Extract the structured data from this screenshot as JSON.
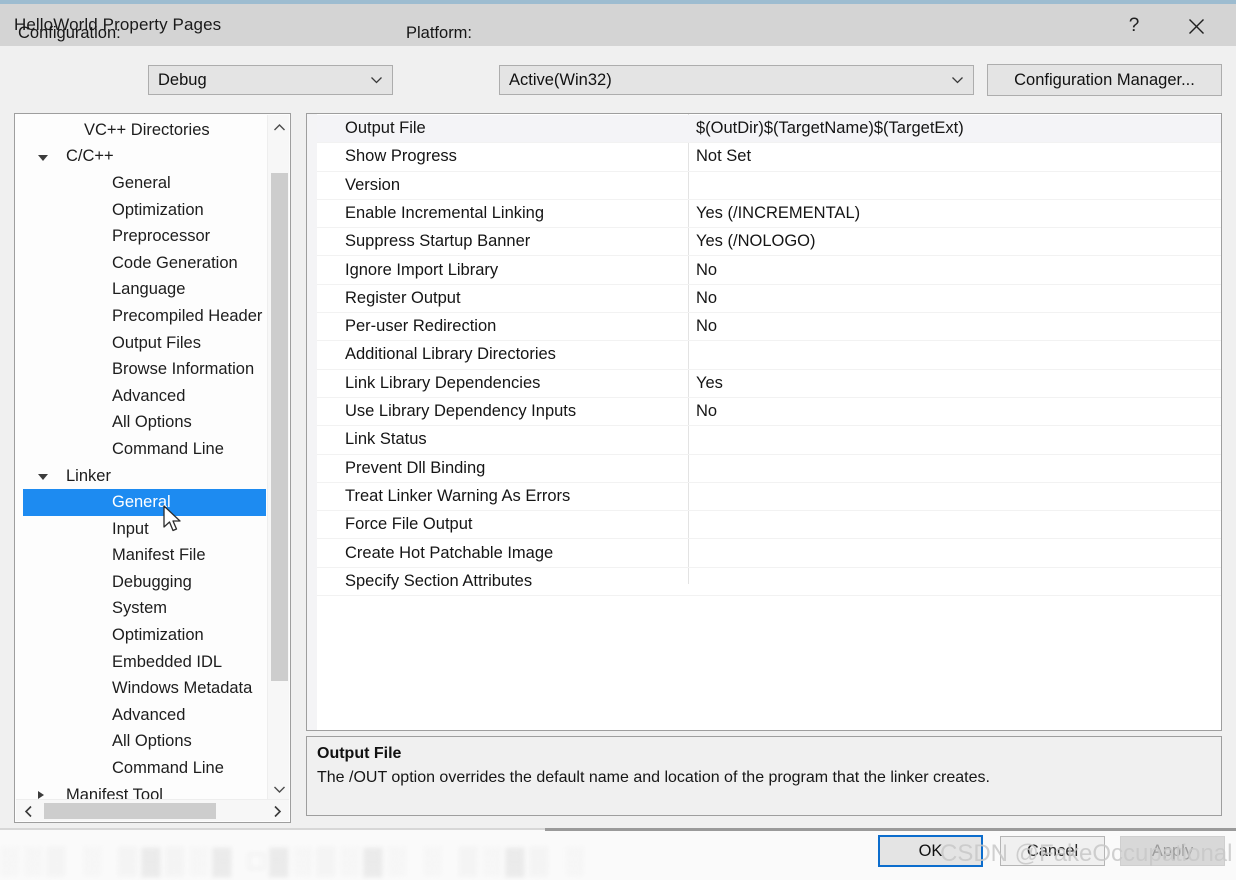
{
  "window": {
    "title": "HelloWorld Property Pages",
    "help_icon": "?",
    "close_icon": "close-icon"
  },
  "configbar": {
    "configuration_label": "Configuration:",
    "configuration_value": "Debug",
    "platform_label": "Platform:",
    "platform_value": "Active(Win32)",
    "configuration_manager_button": "Configuration Manager..."
  },
  "tree": {
    "items": [
      {
        "label": "VC++ Directories",
        "indent": 2,
        "expander": "none",
        "selected": false
      },
      {
        "label": "C/C++",
        "indent": 1,
        "expander": "open",
        "selected": false
      },
      {
        "label": "General",
        "indent": 3,
        "expander": "none",
        "selected": false
      },
      {
        "label": "Optimization",
        "indent": 3,
        "expander": "none",
        "selected": false
      },
      {
        "label": "Preprocessor",
        "indent": 3,
        "expander": "none",
        "selected": false
      },
      {
        "label": "Code Generation",
        "indent": 3,
        "expander": "none",
        "selected": false
      },
      {
        "label": "Language",
        "indent": 3,
        "expander": "none",
        "selected": false
      },
      {
        "label": "Precompiled Header",
        "indent": 3,
        "expander": "none",
        "selected": false
      },
      {
        "label": "Output Files",
        "indent": 3,
        "expander": "none",
        "selected": false
      },
      {
        "label": "Browse Information",
        "indent": 3,
        "expander": "none",
        "selected": false
      },
      {
        "label": "Advanced",
        "indent": 3,
        "expander": "none",
        "selected": false
      },
      {
        "label": "All Options",
        "indent": 3,
        "expander": "none",
        "selected": false
      },
      {
        "label": "Command Line",
        "indent": 3,
        "expander": "none",
        "selected": false
      },
      {
        "label": "Linker",
        "indent": 1,
        "expander": "open",
        "selected": false
      },
      {
        "label": "General",
        "indent": 3,
        "expander": "none",
        "selected": true
      },
      {
        "label": "Input",
        "indent": 3,
        "expander": "none",
        "selected": false
      },
      {
        "label": "Manifest File",
        "indent": 3,
        "expander": "none",
        "selected": false
      },
      {
        "label": "Debugging",
        "indent": 3,
        "expander": "none",
        "selected": false
      },
      {
        "label": "System",
        "indent": 3,
        "expander": "none",
        "selected": false
      },
      {
        "label": "Optimization",
        "indent": 3,
        "expander": "none",
        "selected": false
      },
      {
        "label": "Embedded IDL",
        "indent": 3,
        "expander": "none",
        "selected": false
      },
      {
        "label": "Windows Metadata",
        "indent": 3,
        "expander": "none",
        "selected": false
      },
      {
        "label": "Advanced",
        "indent": 3,
        "expander": "none",
        "selected": false
      },
      {
        "label": "All Options",
        "indent": 3,
        "expander": "none",
        "selected": false
      },
      {
        "label": "Command Line",
        "indent": 3,
        "expander": "none",
        "selected": false
      },
      {
        "label": "Manifest Tool",
        "indent": 1,
        "expander": "closed",
        "selected": false
      }
    ],
    "scroll_up_icon": "chevron-up-icon",
    "scroll_down_icon": "chevron-down-icon",
    "scroll_left_icon": "chevron-left-icon",
    "scroll_right_icon": "chevron-right-icon"
  },
  "grid": {
    "rows": [
      {
        "name": "Output File",
        "value": "$(OutDir)$(TargetName)$(TargetExt)",
        "selected": true
      },
      {
        "name": "Show Progress",
        "value": "Not Set",
        "selected": false
      },
      {
        "name": "Version",
        "value": "",
        "selected": false
      },
      {
        "name": "Enable Incremental Linking",
        "value": "Yes (/INCREMENTAL)",
        "selected": false
      },
      {
        "name": "Suppress Startup Banner",
        "value": "Yes (/NOLOGO)",
        "selected": false
      },
      {
        "name": "Ignore Import Library",
        "value": "No",
        "selected": false
      },
      {
        "name": "Register Output",
        "value": "No",
        "selected": false
      },
      {
        "name": "Per-user Redirection",
        "value": "No",
        "selected": false
      },
      {
        "name": "Additional Library Directories",
        "value": "",
        "selected": false
      },
      {
        "name": "Link Library Dependencies",
        "value": "Yes",
        "selected": false
      },
      {
        "name": "Use Library Dependency Inputs",
        "value": "No",
        "selected": false
      },
      {
        "name": "Link Status",
        "value": "",
        "selected": false
      },
      {
        "name": "Prevent Dll Binding",
        "value": "",
        "selected": false
      },
      {
        "name": "Treat Linker Warning As Errors",
        "value": "",
        "selected": false
      },
      {
        "name": "Force File Output",
        "value": "",
        "selected": false
      },
      {
        "name": "Create Hot Patchable Image",
        "value": "",
        "selected": false
      },
      {
        "name": "Specify Section Attributes",
        "value": "",
        "selected": false
      }
    ]
  },
  "description": {
    "title": "Output File",
    "body": "The /OUT option overrides the default name and location of the program that the linker creates."
  },
  "footer": {
    "ok_label": "OK",
    "cancel_label": "Cancel",
    "apply_label": "Apply"
  },
  "watermark": {
    "text": "CSDN @FakeOccupational"
  },
  "colors": {
    "accent_blue": "#1d8bf1",
    "top_strip": "#9dbcd0",
    "titlebar": "#d4d4d4",
    "dialog_bg": "#f0f0f0",
    "focus_border": "#0c6dcd"
  }
}
